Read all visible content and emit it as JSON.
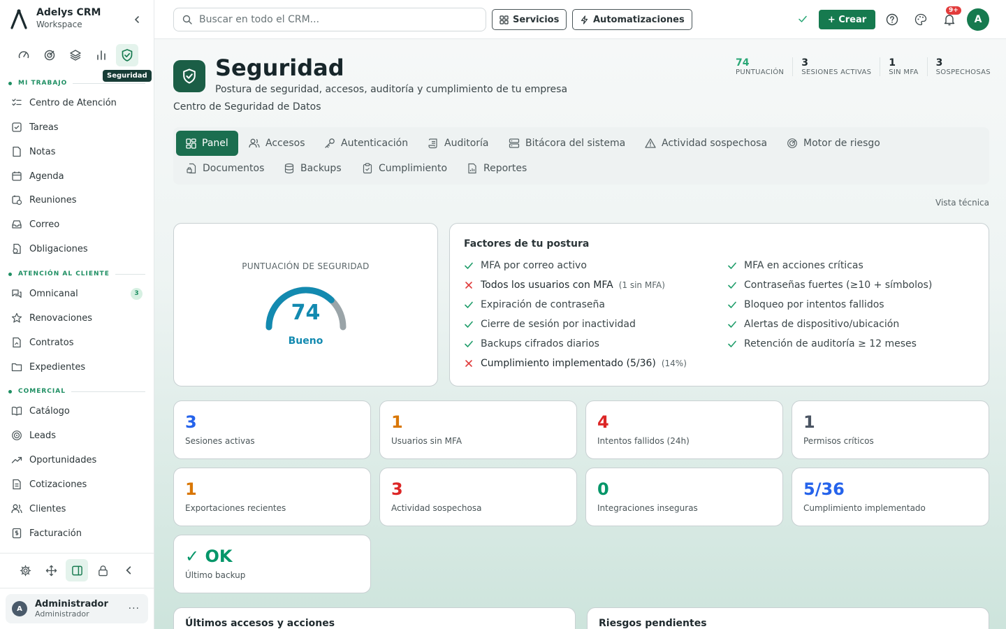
{
  "brand": {
    "name": "Adelys CRM",
    "sub": "Workspace"
  },
  "sidebar": {
    "tooltip": "Seguridad",
    "sections": [
      {
        "label": "MI TRABAJO",
        "items": [
          "Centro de Atención",
          "Tareas",
          "Notas",
          "Agenda",
          "Reuniones",
          "Correo",
          "Obligaciones"
        ]
      },
      {
        "label": "ATENCIÓN AL CLIENTE",
        "items": [
          "Omnicanal",
          "Renovaciones",
          "Contratos",
          "Expedientes"
        ],
        "omnicanal_badge": "3"
      },
      {
        "label": "COMERCIAL",
        "items": [
          "Catálogo",
          "Leads",
          "Oportunidades",
          "Cotizaciones",
          "Clientes",
          "Facturación"
        ]
      }
    ],
    "user": {
      "initial": "A",
      "name": "Administrador",
      "role": "Administrador",
      "more": "···"
    }
  },
  "topbar": {
    "search_placeholder": "Buscar en todo el CRM...",
    "services": "Servicios",
    "automations": "Automatizaciones",
    "create": "+ Crear",
    "notif_badge": "9+",
    "avatar": "A"
  },
  "header": {
    "title": "Seguridad",
    "subtitle": "Postura de seguridad, accesos, auditoría y cumplimiento de tu empresa",
    "caption": "Centro de Seguridad de Datos",
    "kpis": [
      {
        "value": "74",
        "label": "PUNTUACIÓN"
      },
      {
        "value": "3",
        "label": "SESIONES ACTIVAS"
      },
      {
        "value": "1",
        "label": "SIN MFA"
      },
      {
        "value": "3",
        "label": "SOSPECHOSAS"
      }
    ]
  },
  "tabs": [
    "Panel",
    "Accesos",
    "Autenticación",
    "Auditoría",
    "Bitácora del sistema",
    "Actividad sospechosa",
    "Motor de riesgo",
    "Documentos",
    "Backups",
    "Cumplimiento",
    "Reportes"
  ],
  "vista_tecnica": "Vista técnica",
  "score": {
    "label": "PUNTUACIÓN DE SEGURIDAD",
    "value": "74",
    "rating": "Bueno",
    "gauge_fraction": 0.74
  },
  "factors": {
    "title": "Factores de tu postura",
    "left": [
      {
        "text": "MFA por correo activo",
        "ok": true,
        "note": ""
      },
      {
        "text": "Todos los usuarios con MFA",
        "ok": false,
        "note": "(1 sin MFA)"
      },
      {
        "text": "Expiración de contraseña",
        "ok": true,
        "note": ""
      },
      {
        "text": "Cierre de sesión por inactividad",
        "ok": true,
        "note": ""
      },
      {
        "text": "Backups cifrados diarios",
        "ok": true,
        "note": ""
      },
      {
        "text": "Cumplimiento implementado (5/36)",
        "ok": false,
        "note": "(14%)"
      }
    ],
    "right": [
      {
        "text": "MFA en acciones críticas",
        "ok": true,
        "note": ""
      },
      {
        "text": "Contraseñas fuertes (≥10 + símbolos)",
        "ok": true,
        "note": ""
      },
      {
        "text": "Bloqueo por intentos fallidos",
        "ok": true,
        "note": ""
      },
      {
        "text": "Alertas de dispositivo/ubicación",
        "ok": true,
        "note": ""
      },
      {
        "text": "Retención de auditoría ≥ 12 meses",
        "ok": true,
        "note": ""
      }
    ]
  },
  "stats": [
    {
      "value": "3",
      "label": "Sesiones activas",
      "color": "#2563eb"
    },
    {
      "value": "1",
      "label": "Usuarios sin MFA",
      "color": "#d97706"
    },
    {
      "value": "4",
      "label": "Intentos fallidos (24h)",
      "color": "#dc2626"
    },
    {
      "value": "1",
      "label": "Permisos críticos",
      "color": "#4b5563"
    },
    {
      "value": "1",
      "label": "Exportaciones recientes",
      "color": "#d97706"
    },
    {
      "value": "3",
      "label": "Actividad sospechosa",
      "color": "#dc2626"
    },
    {
      "value": "0",
      "label": "Integraciones inseguras",
      "color": "#059669"
    },
    {
      "value": "5/36",
      "label": "Cumplimiento implementado",
      "color": "#2563eb"
    },
    {
      "value": "✓ OK",
      "label": "Último backup",
      "color": "#059669"
    }
  ],
  "bottom": {
    "accesses_title": "Últimos accesos y acciones",
    "risks_title": "Riesgos pendientes"
  },
  "colors": {
    "brand_green": "#167a4f",
    "gauge_blue": "#138ab0",
    "ok": "#1f9d6a",
    "bad": "#e03c3c"
  }
}
